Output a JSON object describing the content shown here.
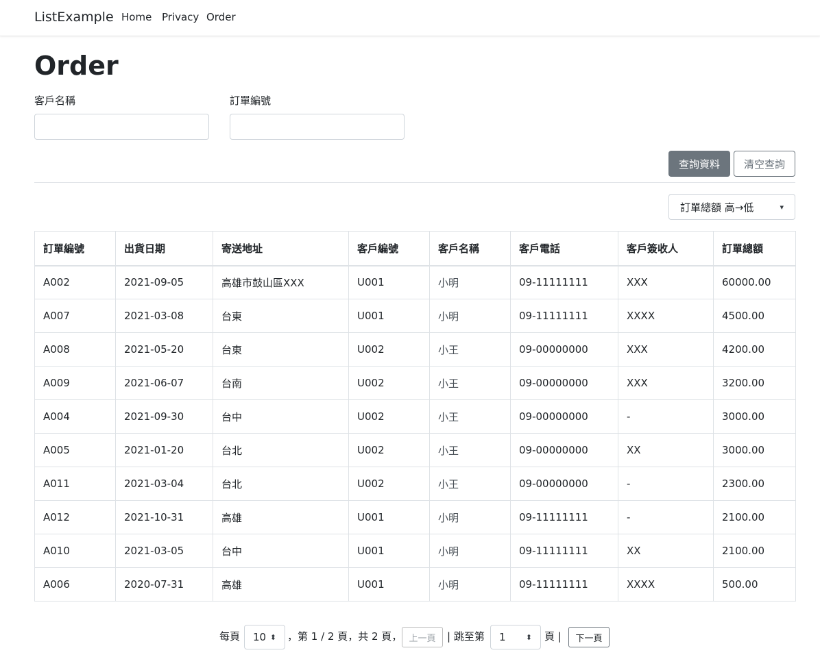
{
  "nav": {
    "brand": "ListExample",
    "links": [
      "Home",
      "Privacy",
      "Order"
    ]
  },
  "page": {
    "title": "Order"
  },
  "filters": {
    "customer_name_label": "客戶名稱",
    "customer_name_value": "",
    "order_no_label": "訂單編號",
    "order_no_value": ""
  },
  "actions": {
    "search_label": "查詢資料",
    "clear_label": "清空查詢"
  },
  "sort": {
    "selected": "訂單總額 高→低"
  },
  "table": {
    "columns": [
      "訂單編號",
      "出貨日期",
      "寄送地址",
      "客戶編號",
      "客戶名稱",
      "客戶電話",
      "客戶簽收人",
      "訂單總額"
    ],
    "rows": [
      [
        "A002",
        "2021-09-05",
        "高雄市鼓山區XXX",
        "U001",
        "小明",
        "09-11111111",
        "XXX",
        "60000.00"
      ],
      [
        "A007",
        "2021-03-08",
        "台東",
        "U001",
        "小明",
        "09-11111111",
        "XXXX",
        "4500.00"
      ],
      [
        "A008",
        "2021-05-20",
        "台東",
        "U002",
        "小王",
        "09-00000000",
        "XXX",
        "4200.00"
      ],
      [
        "A009",
        "2021-06-07",
        "台南",
        "U002",
        "小王",
        "09-00000000",
        "XXX",
        "3200.00"
      ],
      [
        "A004",
        "2021-09-30",
        "台中",
        "U002",
        "小王",
        "09-00000000",
        "-",
        "3000.00"
      ],
      [
        "A005",
        "2021-01-20",
        "台北",
        "U002",
        "小王",
        "09-00000000",
        "XX",
        "3000.00"
      ],
      [
        "A011",
        "2021-03-04",
        "台北",
        "U002",
        "小王",
        "09-00000000",
        "-",
        "2300.00"
      ],
      [
        "A012",
        "2021-10-31",
        "高雄",
        "U001",
        "小明",
        "09-11111111",
        "-",
        "2100.00"
      ],
      [
        "A010",
        "2021-03-05",
        "台中",
        "U001",
        "小明",
        "09-11111111",
        "XX",
        "2100.00"
      ],
      [
        "A006",
        "2020-07-31",
        "高雄",
        "U001",
        "小明",
        "09-11111111",
        "XXXX",
        "500.00"
      ]
    ]
  },
  "pager": {
    "per_page_label": "每頁",
    "per_page_value": "10",
    "page_info": "，第 1 / 2 頁，共 2 頁，",
    "prev_label": "上一頁",
    "jump_label": "| 跳至第",
    "jump_value": "1",
    "page_suffix": "頁 |",
    "next_label": "下一頁"
  }
}
